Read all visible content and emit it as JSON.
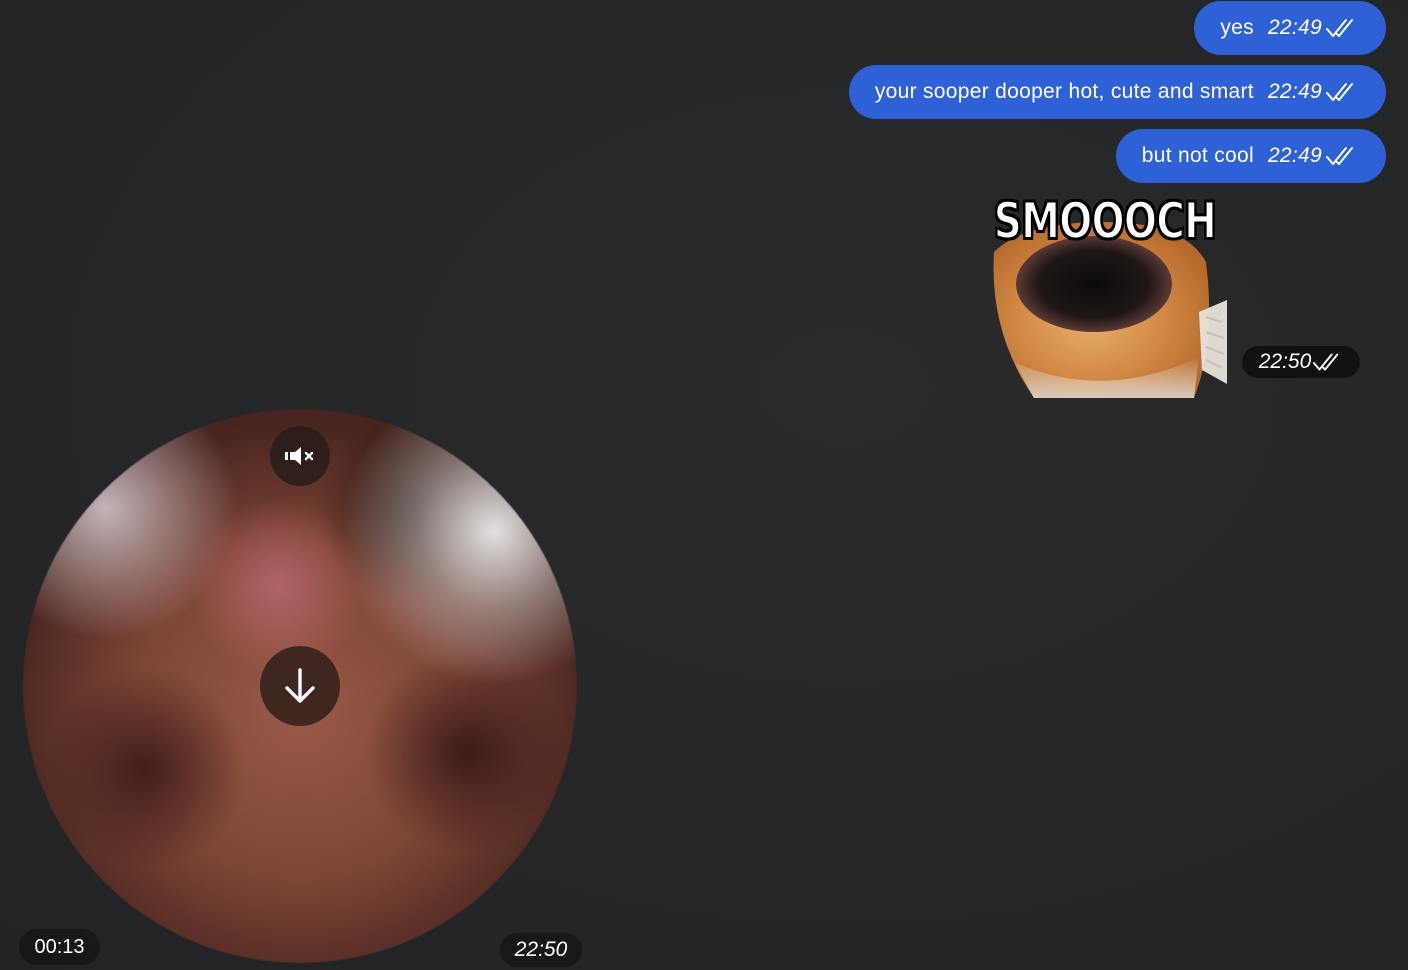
{
  "messages": [
    {
      "text": "yes",
      "time": "22:49",
      "status_icon": "double-check-icon"
    },
    {
      "text": "your sooper dooper hot, cute and smart",
      "time": "22:49",
      "status_icon": "double-check-icon"
    },
    {
      "text": "but not cool",
      "time": "22:49",
      "status_icon": "double-check-icon"
    }
  ],
  "sticker": {
    "caption": "SMOOOCH",
    "time": "22:50",
    "status_icon": "double-check-icon"
  },
  "video_note": {
    "duration": "00:13",
    "time": "22:50",
    "mute_icon": "muted-speaker-icon",
    "download_icon": "download-arrow-icon"
  },
  "colors": {
    "background": "#242628",
    "outgoing_bubble": "#2f61d6"
  }
}
